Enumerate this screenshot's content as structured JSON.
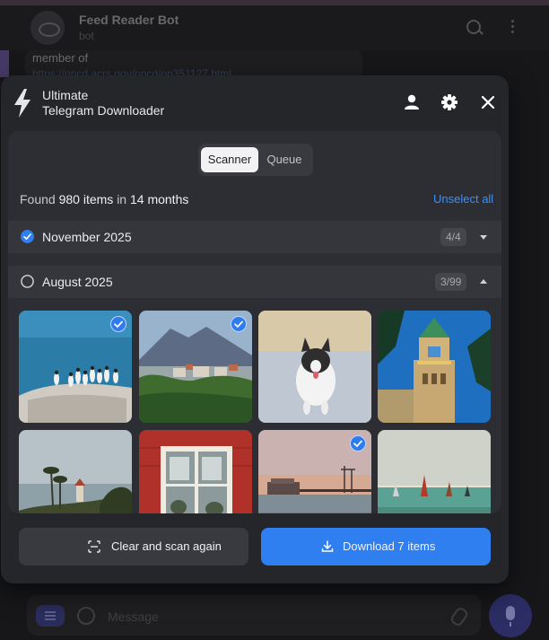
{
  "background": {
    "chat_title": "Feed Reader Bot",
    "chat_subtitle": "bot",
    "message_text": "member of",
    "message_link": "https://opcd.acrs.gov/opcd/op351127.html",
    "input_placeholder": "Message"
  },
  "app": {
    "title_line1": "Ultimate",
    "title_line2": "Telegram Downloader",
    "icons": [
      "lightning-icon",
      "user-icon",
      "gear-icon",
      "close-icon"
    ]
  },
  "tabs": [
    {
      "label": "Scanner",
      "active": true
    },
    {
      "label": "Queue",
      "active": false
    }
  ],
  "summary": {
    "prefix": "Found",
    "items": "980 items",
    "middle": "in",
    "months": "14 months",
    "unselect_label": "Unselect all"
  },
  "months": [
    {
      "label": "November 2025",
      "count": "4/4",
      "checked": true,
      "expanded": false
    },
    {
      "label": "August 2025",
      "count": "3/99",
      "checked": false,
      "expanded": true
    }
  ],
  "photos": [
    {
      "subject": "seabirds on rock",
      "selected": true
    },
    {
      "subject": "mountain town",
      "selected": true
    },
    {
      "subject": "dog running in snow",
      "selected": false
    },
    {
      "subject": "church tower",
      "selected": false
    },
    {
      "subject": "palm trees coast",
      "selected": false
    },
    {
      "subject": "red window frame",
      "selected": false
    },
    {
      "subject": "pier at sunset",
      "selected": true
    },
    {
      "subject": "kitesurfing sea",
      "selected": false
    }
  ],
  "actions": {
    "clear_label": "Clear and scan again",
    "download_label": "Download 7 items"
  },
  "colors": {
    "accent": "#2f7ff0",
    "link": "#3b91f7",
    "modal_bg": "#25262a",
    "panel_bg": "#2d2e33"
  }
}
